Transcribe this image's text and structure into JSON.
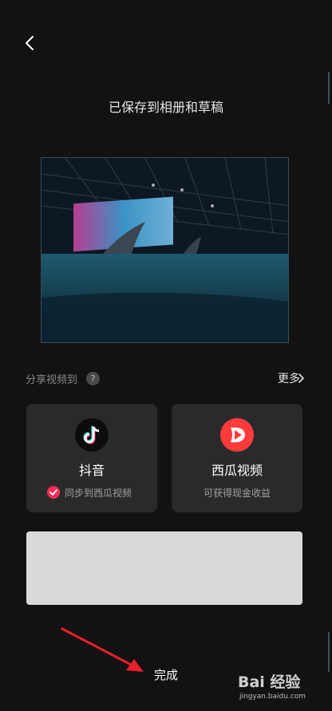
{
  "header": {
    "back_icon": "chevron-left-icon",
    "title": "已保存到相册和草稿"
  },
  "share": {
    "label": "分享视频到",
    "help_icon": "?",
    "more_label": "更多"
  },
  "cards": {
    "douyin": {
      "title": "抖音",
      "sync_label": "同步到西瓜视频",
      "icon": "douyin-logo-icon"
    },
    "xigua": {
      "title": "西瓜视频",
      "subtitle": "可获得现金收益",
      "icon": "xigua-logo-icon"
    }
  },
  "footer": {
    "done_label": "完成"
  },
  "watermark": {
    "text": "Bai 经验",
    "url": "jingyan.baidu.com"
  },
  "colors": {
    "background": "#121212",
    "card": "#2a2a2a",
    "accent": "#fe2c55",
    "xigua_red": "#ff3b3b",
    "annotation_arrow": "#e8202a"
  }
}
